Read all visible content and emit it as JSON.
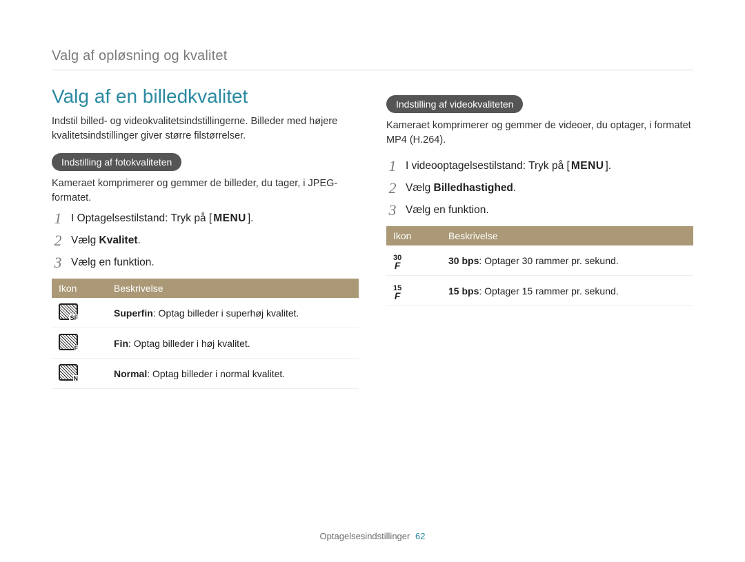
{
  "breadcrumb": "Valg af opløsning og kvalitet",
  "title": "Valg af en billedkvalitet",
  "intro": "Indstil billed- og videokvalitetsindstillingerne. Billeder med højere kvalitetsindstillinger giver større filstørrelser.",
  "left": {
    "pill": "Indstilling af fotokvaliteten",
    "desc": "Kameraet komprimerer og gemmer de billeder, du tager, i JPEG-formatet.",
    "steps": {
      "s1_prefix": "I Optagelsestilstand: Tryk på [",
      "s1_menu": "MENU",
      "s1_suffix": "].",
      "s2_prefix": "Vælg ",
      "s2_bold": "Kvalitet",
      "s2_suffix": ".",
      "s3": "Vælg en funktion."
    },
    "table": {
      "h_icon": "Ikon",
      "h_desc": "Beskrivelse",
      "rows": [
        {
          "iconLetter": "SF",
          "bold": "Superfin",
          "text": ": Optag billeder i superhøj kvalitet."
        },
        {
          "iconLetter": "F",
          "bold": "Fin",
          "text": ": Optag billeder i høj kvalitet."
        },
        {
          "iconLetter": "N",
          "bold": "Normal",
          "text": ": Optag billeder i normal kvalitet."
        }
      ]
    }
  },
  "right": {
    "pill": "Indstilling af videokvaliteten",
    "desc": "Kameraet komprimerer og gemmer de videoer, du optager, i formatet MP4 (H.264).",
    "steps": {
      "s1_prefix": "I videooptagelsestilstand: Tryk på [",
      "s1_menu": "MENU",
      "s1_suffix": "].",
      "s2_prefix": "Vælg ",
      "s2_bold": "Billedhastighed",
      "s2_suffix": ".",
      "s3": "Vælg en funktion."
    },
    "table": {
      "h_icon": "Ikon",
      "h_desc": "Beskrivelse",
      "rows": [
        {
          "fps": "30",
          "bold": "30 bps",
          "text": ": Optager 30 rammer pr. sekund."
        },
        {
          "fps": "15",
          "bold": "15 bps",
          "text": ": Optager 15 rammer pr. sekund."
        }
      ]
    }
  },
  "footer": {
    "section": "Optagelsesindstillinger",
    "page": "62"
  }
}
